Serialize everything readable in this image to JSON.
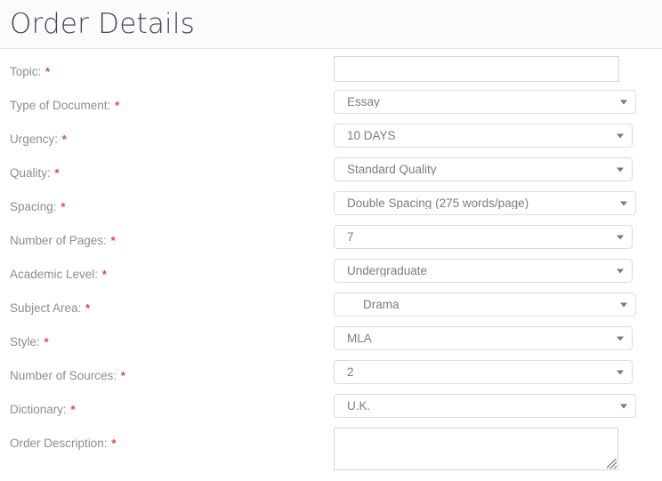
{
  "header": {
    "title": "Order Details"
  },
  "required_marker": "*",
  "form": {
    "rows": [
      {
        "label": "Topic:",
        "required": true,
        "control": "text",
        "value": "",
        "placeholder": "",
        "name": "topic"
      },
      {
        "label": "Type of Document:",
        "required": true,
        "control": "select",
        "value": "Essay",
        "width": "w-340",
        "indented": false,
        "name": "type-of-document"
      },
      {
        "label": "Urgency:",
        "required": true,
        "control": "select",
        "value": "10 DAYS",
        "width": "w-336",
        "indented": false,
        "name": "urgency"
      },
      {
        "label": "Quality:",
        "required": true,
        "control": "select",
        "value": "Standard Quality",
        "width": "w-336",
        "indented": false,
        "name": "quality"
      },
      {
        "label": "Spacing:",
        "required": true,
        "control": "select",
        "value": "Double Spacing (275 words/page)",
        "width": "w-340",
        "indented": false,
        "name": "spacing"
      },
      {
        "label": "Number of Pages:",
        "required": true,
        "control": "select",
        "value": "7",
        "width": "w-336",
        "indented": false,
        "name": "number-of-pages"
      },
      {
        "label": "Academic Level:",
        "required": true,
        "control": "select",
        "value": "Undergraduate",
        "width": "w-336",
        "indented": false,
        "name": "academic-level"
      },
      {
        "label": "Subject Area:",
        "required": true,
        "control": "select",
        "value": "Drama",
        "width": "w-340",
        "indented": true,
        "name": "subject-area"
      },
      {
        "label": "Style:",
        "required": true,
        "control": "select",
        "value": "MLA",
        "width": "w-336",
        "indented": false,
        "name": "style"
      },
      {
        "label": "Number of Sources:",
        "required": true,
        "control": "select",
        "value": "2",
        "width": "w-336",
        "indented": false,
        "name": "number-of-sources"
      },
      {
        "label": "Dictionary:",
        "required": true,
        "control": "select",
        "value": "U.K.",
        "width": "w-340",
        "indented": false,
        "name": "dictionary"
      },
      {
        "label": "Order Description:",
        "required": true,
        "control": "textarea",
        "value": "",
        "placeholder": "",
        "name": "order-description"
      }
    ]
  },
  "icons": {
    "dropdown": "chevron-down-icon",
    "resize": "resize-grip-icon"
  },
  "colors": {
    "title": "#3e4855",
    "label": "#8d8d8d",
    "required": "#e8433f",
    "value": "#7c7c7c",
    "border": "#dcdcdc",
    "header_bg": "#fbfbfb"
  }
}
